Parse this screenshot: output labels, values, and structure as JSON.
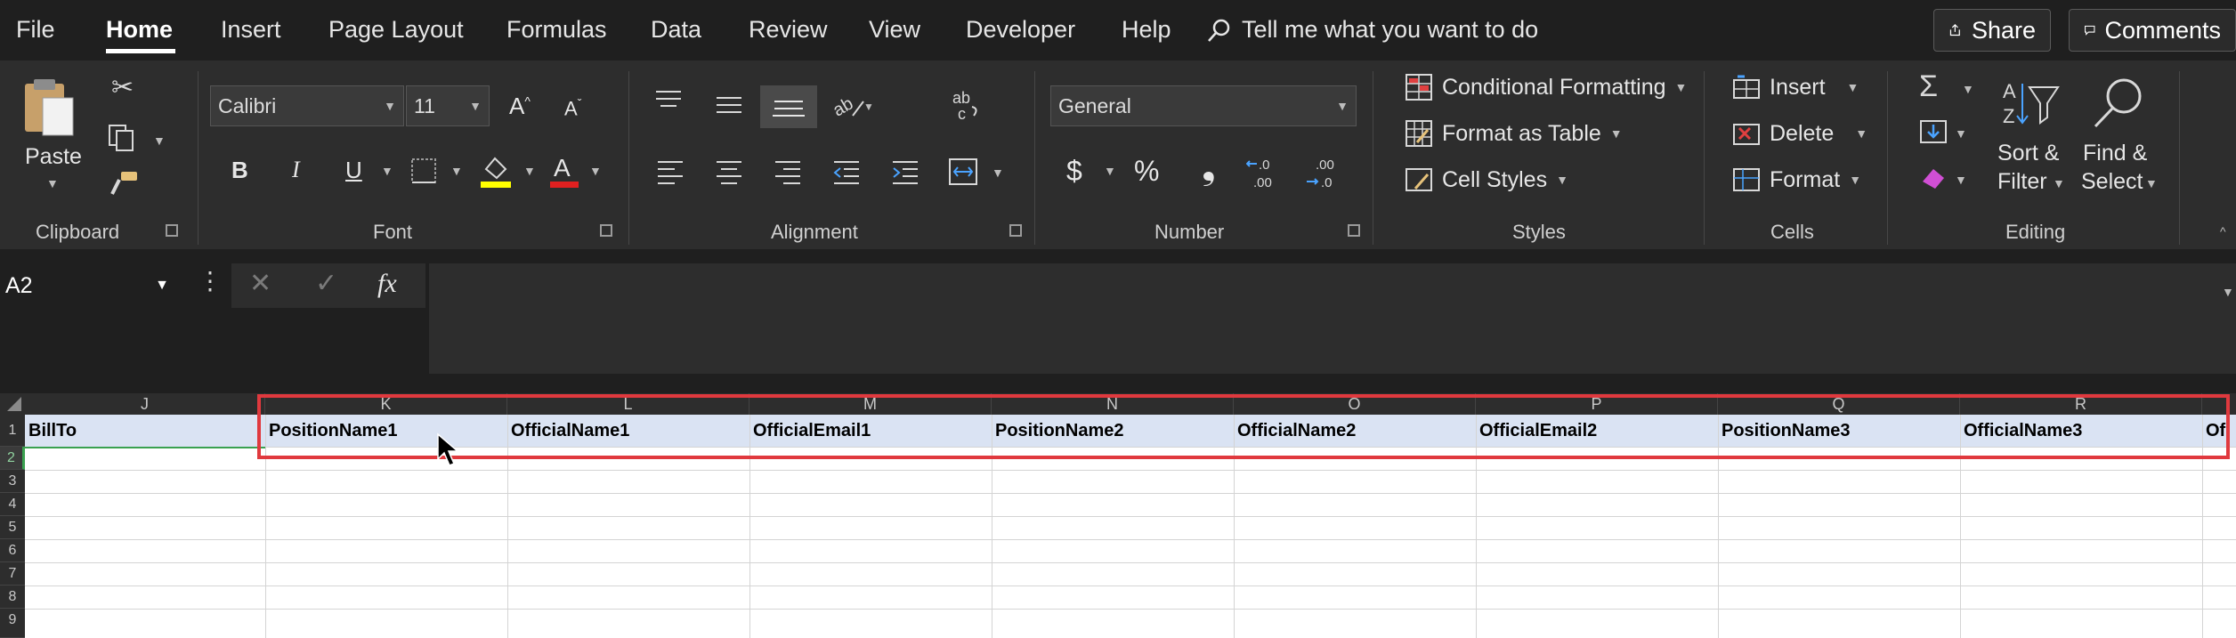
{
  "menu": {
    "tabs": [
      "File",
      "Home",
      "Insert",
      "Page Layout",
      "Formulas",
      "Data",
      "Review",
      "View",
      "Developer",
      "Help"
    ],
    "active_tab": "Home",
    "tell_me": "Tell me what you want to do",
    "share": "Share",
    "comments": "Comments"
  },
  "ribbon": {
    "clipboard": {
      "label": "Clipboard",
      "paste": "Paste"
    },
    "font": {
      "label": "Font",
      "name": "Calibri",
      "size": "11",
      "bold": "B",
      "italic": "I",
      "underline": "U",
      "grow": "A",
      "shrink": "A"
    },
    "alignment": {
      "label": "Alignment"
    },
    "number": {
      "label": "Number",
      "format": "General",
      "currency": "$",
      "percent": "%",
      "comma": "❟"
    },
    "styles": {
      "label": "Styles",
      "conditional": "Conditional Formatting",
      "format_table": "Format as Table",
      "cell_styles": "Cell Styles"
    },
    "cells": {
      "label": "Cells",
      "insert": "Insert",
      "delete": "Delete",
      "format": "Format"
    },
    "editing": {
      "label": "Editing",
      "sort_filter_1": "Sort &",
      "sort_filter_2": "Filter",
      "find_select_1": "Find &",
      "find_select_2": "Select"
    }
  },
  "formula_bar": {
    "name_box": "A2",
    "fx": "fx",
    "value": ""
  },
  "grid": {
    "columns": [
      "J",
      "K",
      "L",
      "M",
      "N",
      "O",
      "P",
      "Q",
      "R"
    ],
    "row_numbers": [
      "1",
      "2",
      "3",
      "4",
      "5",
      "6",
      "7",
      "8",
      "9"
    ],
    "selected_row": "2",
    "row1_cells": [
      "BillTo",
      "PositionName1",
      "OfficialName1",
      "OfficialEmail1",
      "PositionName2",
      "OfficialName2",
      "OfficialEmail2",
      "PositionName3",
      "OfficialName3",
      "Of"
    ]
  },
  "colors": {
    "accent": "#3aa150",
    "highlight_box": "#e0393e",
    "header_row_fill": "#dae3f3"
  }
}
